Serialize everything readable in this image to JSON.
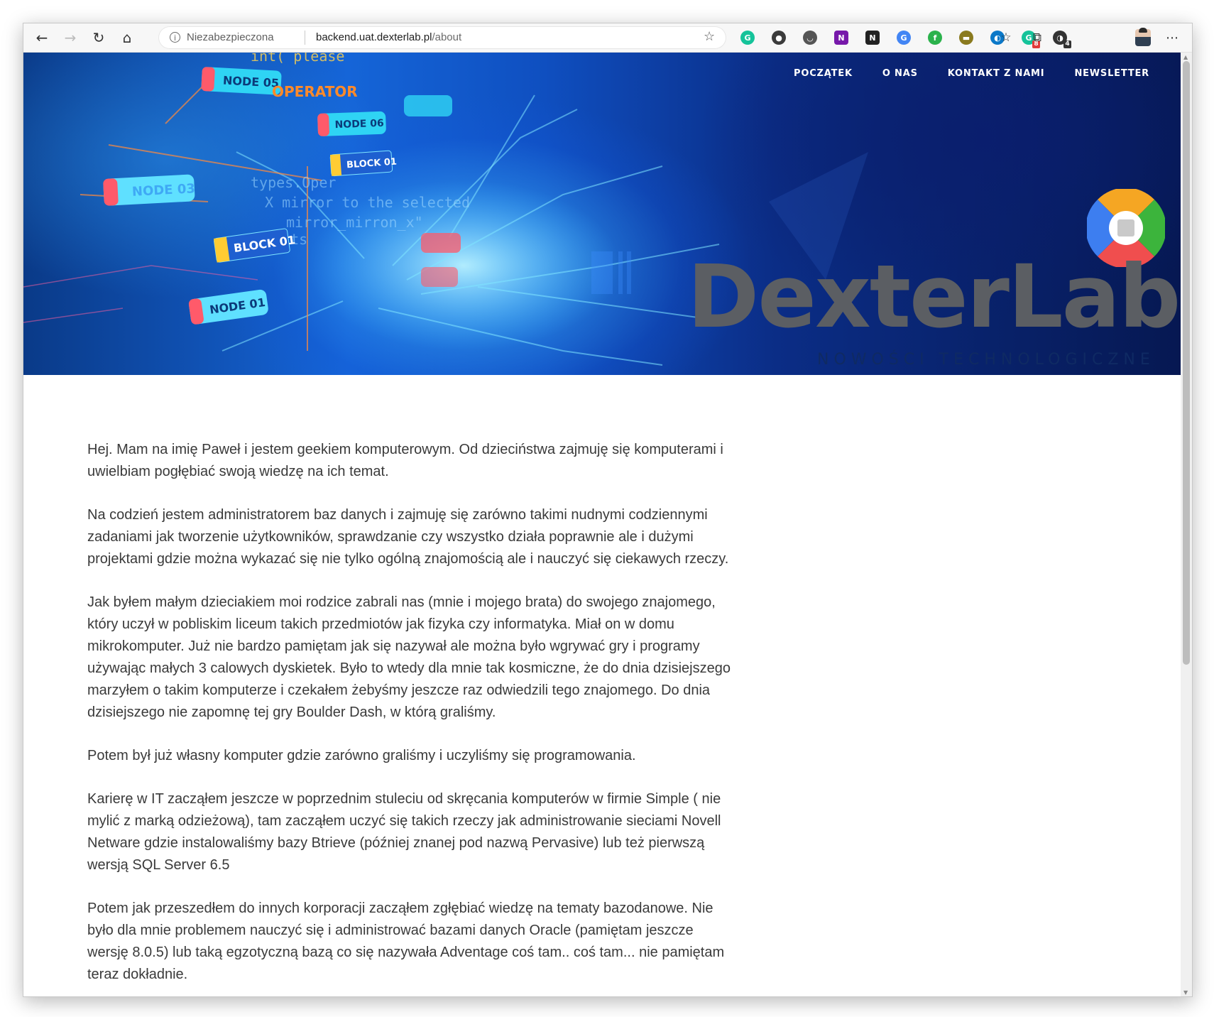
{
  "browser": {
    "security_label": "Niezabezpieczona",
    "url_host": "backend.uat.dexterlab.pl",
    "url_path": "/about",
    "extensions": [
      {
        "name": "grammarly-icon",
        "color": "#15c39a",
        "glyph": "G"
      },
      {
        "name": "password-manager-icon",
        "color": "#3b3b3b",
        "glyph": "●"
      },
      {
        "name": "pocket-icon",
        "color": "#555555",
        "glyph": "◡"
      },
      {
        "name": "onenote-icon",
        "color": "#7719aa",
        "glyph": "N"
      },
      {
        "name": "notion-icon",
        "color": "#222222",
        "glyph": "N"
      },
      {
        "name": "google-translate-icon",
        "color": "#4285f4",
        "glyph": "G"
      },
      {
        "name": "feedly-icon",
        "color": "#2bb24c",
        "glyph": "f"
      },
      {
        "name": "color-picker-icon",
        "color": "#8a7a1e",
        "glyph": "▬"
      },
      {
        "name": "cloud-icon",
        "color": "#0b78c8",
        "glyph": "◐"
      },
      {
        "name": "grammarly-counter-icon",
        "color": "#15c39a",
        "glyph": "G",
        "badge": "8"
      },
      {
        "name": "sync-icon",
        "color": "#333333",
        "glyph": "◑",
        "badge": "4"
      }
    ]
  },
  "nav": {
    "items": [
      "POCZĄTEK",
      "O NAS",
      "KONTAKT Z NAMI",
      "NEWSLETTER"
    ]
  },
  "hero": {
    "logo_text": "DexterLab",
    "tagline": "NOWOŚCI TECHNOLOGICZNE",
    "node_labels": [
      "NODE 05",
      "OPERATOR",
      "NODE 06",
      "BLOCK 01",
      "NODE 03",
      "BLOCK 01",
      "NODE 01"
    ],
    "code_lines": [
      "int( please",
      "types.Oper",
      "X mirror to the selected",
      "mirror_mirron_x\"",
      "jects"
    ]
  },
  "content": {
    "paragraphs": [
      [
        "Hej. Mam na imię Paweł i jestem geekiem komputerowym. Od dzieciństwa zajmuję się komputerami i",
        "uwielbiam pogłębiać swoją wiedzę na ich temat."
      ],
      [
        "Na codzień jestem administratorem baz danych i zajmuję się zarówno takimi nudnymi codziennymi",
        "zadaniami jak tworzenie użytkowników, sprawdzanie czy wszystko działa poprawnie ale i dużymi",
        "projektami gdzie można wykazać się nie tylko ogólną znajomością ale i nauczyć się ciekawych rzeczy."
      ],
      [
        "Jak byłem małym dzieciakiem moi rodzice zabrali nas (mnie i mojego brata) do swojego znajomego,",
        "który uczył w pobliskim liceum takich przedmiotów jak fizyka czy informatyka. Miał on w domu",
        "mikrokomputer. Już nie bardzo pamiętam jak się nazywał ale można było wgrywać gry i programy",
        "używając małych 3 calowych dyskietek. Było to wtedy dla mnie tak kosmiczne, że do dnia dzisiejszego",
        "marzyłem o takim komputerze i czekałem żebyśmy jeszcze raz odwiedzili tego znajomego. Do dnia",
        "dzisiejszego nie zapomnę tej gry Boulder Dash, w którą graliśmy."
      ],
      [
        "Potem był już własny komputer gdzie zarówno graliśmy i uczyliśmy się programowania."
      ],
      [
        "Karierę w IT zacząłem jeszcze w poprzednim stuleciu od skręcania komputerów w firmie Simple ( nie",
        "mylić z marką odzieżową), tam zacząłem uczyć się takich rzeczy jak administrowanie sieciami Novell",
        "Netware gdzie instalowaliśmy bazy Btrieve (później znanej pod nazwą Pervasive) lub też pierwszą",
        "wersją SQL Server 6.5"
      ],
      [
        "Potem jak przeszedłem do innych korporacji zacząłem zgłębiać wiedzę na tematy bazodanowe. Nie",
        "było dla mnie problemem nauczyć się i administrować bazami danych Oracle (pamiętam jeszcze",
        "wersję 8.0.5) lub taką egzotyczną bazą co się nazywała Adventage coś tam.. coś tam... nie pamiętam",
        "teraz dokładnie."
      ]
    ]
  },
  "colors": {
    "logo_gray": "#5b5e63",
    "logo_orange": "#f5a623",
    "logo_green": "#3cb43c",
    "logo_red": "#f04e4e",
    "logo_blue": "#3d7ef0",
    "text": "#3a3a3a"
  }
}
